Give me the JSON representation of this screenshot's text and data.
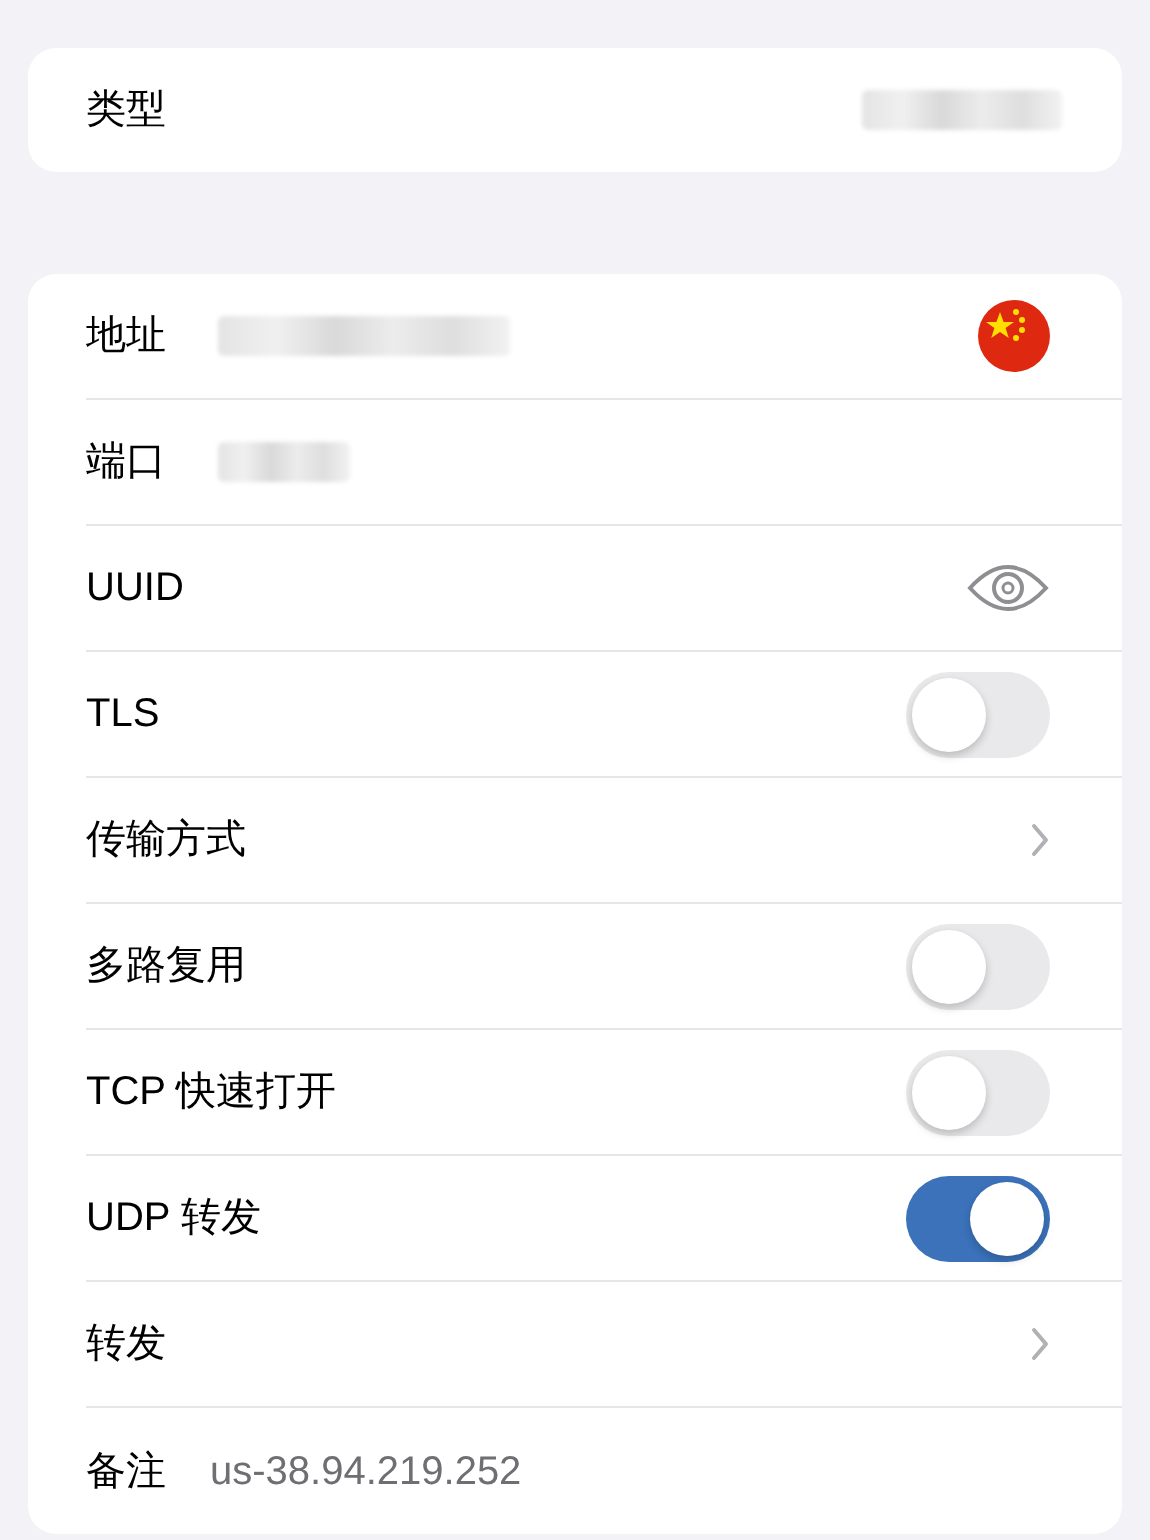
{
  "type_card": {
    "label": "类型",
    "value_redacted": true
  },
  "rows": [
    {
      "kind": "value",
      "label": "地址",
      "value_redacted": true,
      "flag": true
    },
    {
      "kind": "value",
      "label": "端口",
      "value_redacted": true,
      "flag": false
    },
    {
      "kind": "reveal",
      "label": "UUID"
    },
    {
      "kind": "toggle",
      "label": "TLS",
      "on": false
    },
    {
      "kind": "link",
      "label": "传输方式"
    },
    {
      "kind": "toggle",
      "label": "多路复用",
      "on": false
    },
    {
      "kind": "toggle",
      "label": "TCP 快速打开",
      "on": false
    },
    {
      "kind": "toggle",
      "label": "UDP 转发",
      "on": true
    },
    {
      "kind": "link",
      "label": "转发"
    },
    {
      "kind": "text",
      "label": "备注",
      "value": "us-38.94.219.252"
    }
  ]
}
